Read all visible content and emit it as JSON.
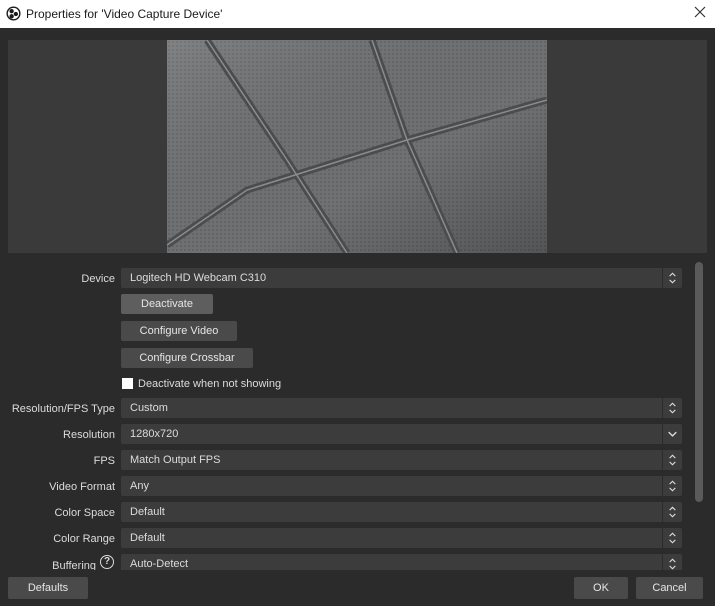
{
  "window": {
    "title": "Properties for 'Video Capture Device'",
    "icon": "obs-icon",
    "close_icon": "close-icon"
  },
  "form": {
    "device": {
      "label": "Device",
      "value": "Logitech HD Webcam C310"
    },
    "buttons": {
      "deactivate": "Deactivate",
      "configure_video": "Configure Video",
      "configure_crossbar": "Configure Crossbar"
    },
    "deactivate_when_not_showing": {
      "label": "Deactivate when not showing",
      "checked": false
    },
    "resolution_fps_type": {
      "label": "Resolution/FPS Type",
      "value": "Custom"
    },
    "resolution": {
      "label": "Resolution",
      "value": "1280x720"
    },
    "fps": {
      "label": "FPS",
      "value": "Match Output FPS"
    },
    "video_format": {
      "label": "Video Format",
      "value": "Any"
    },
    "color_space": {
      "label": "Color Space",
      "value": "Default"
    },
    "color_range": {
      "label": "Color Range",
      "value": "Default"
    },
    "buffering": {
      "label": "Buffering",
      "value": "Auto-Detect",
      "help_icon": "help-icon"
    }
  },
  "footer": {
    "defaults": "Defaults",
    "ok": "OK",
    "cancel": "Cancel"
  },
  "colors": {
    "background": "#2b2b2b",
    "field": "#3c3c3c",
    "button": "#4a4a4a"
  }
}
